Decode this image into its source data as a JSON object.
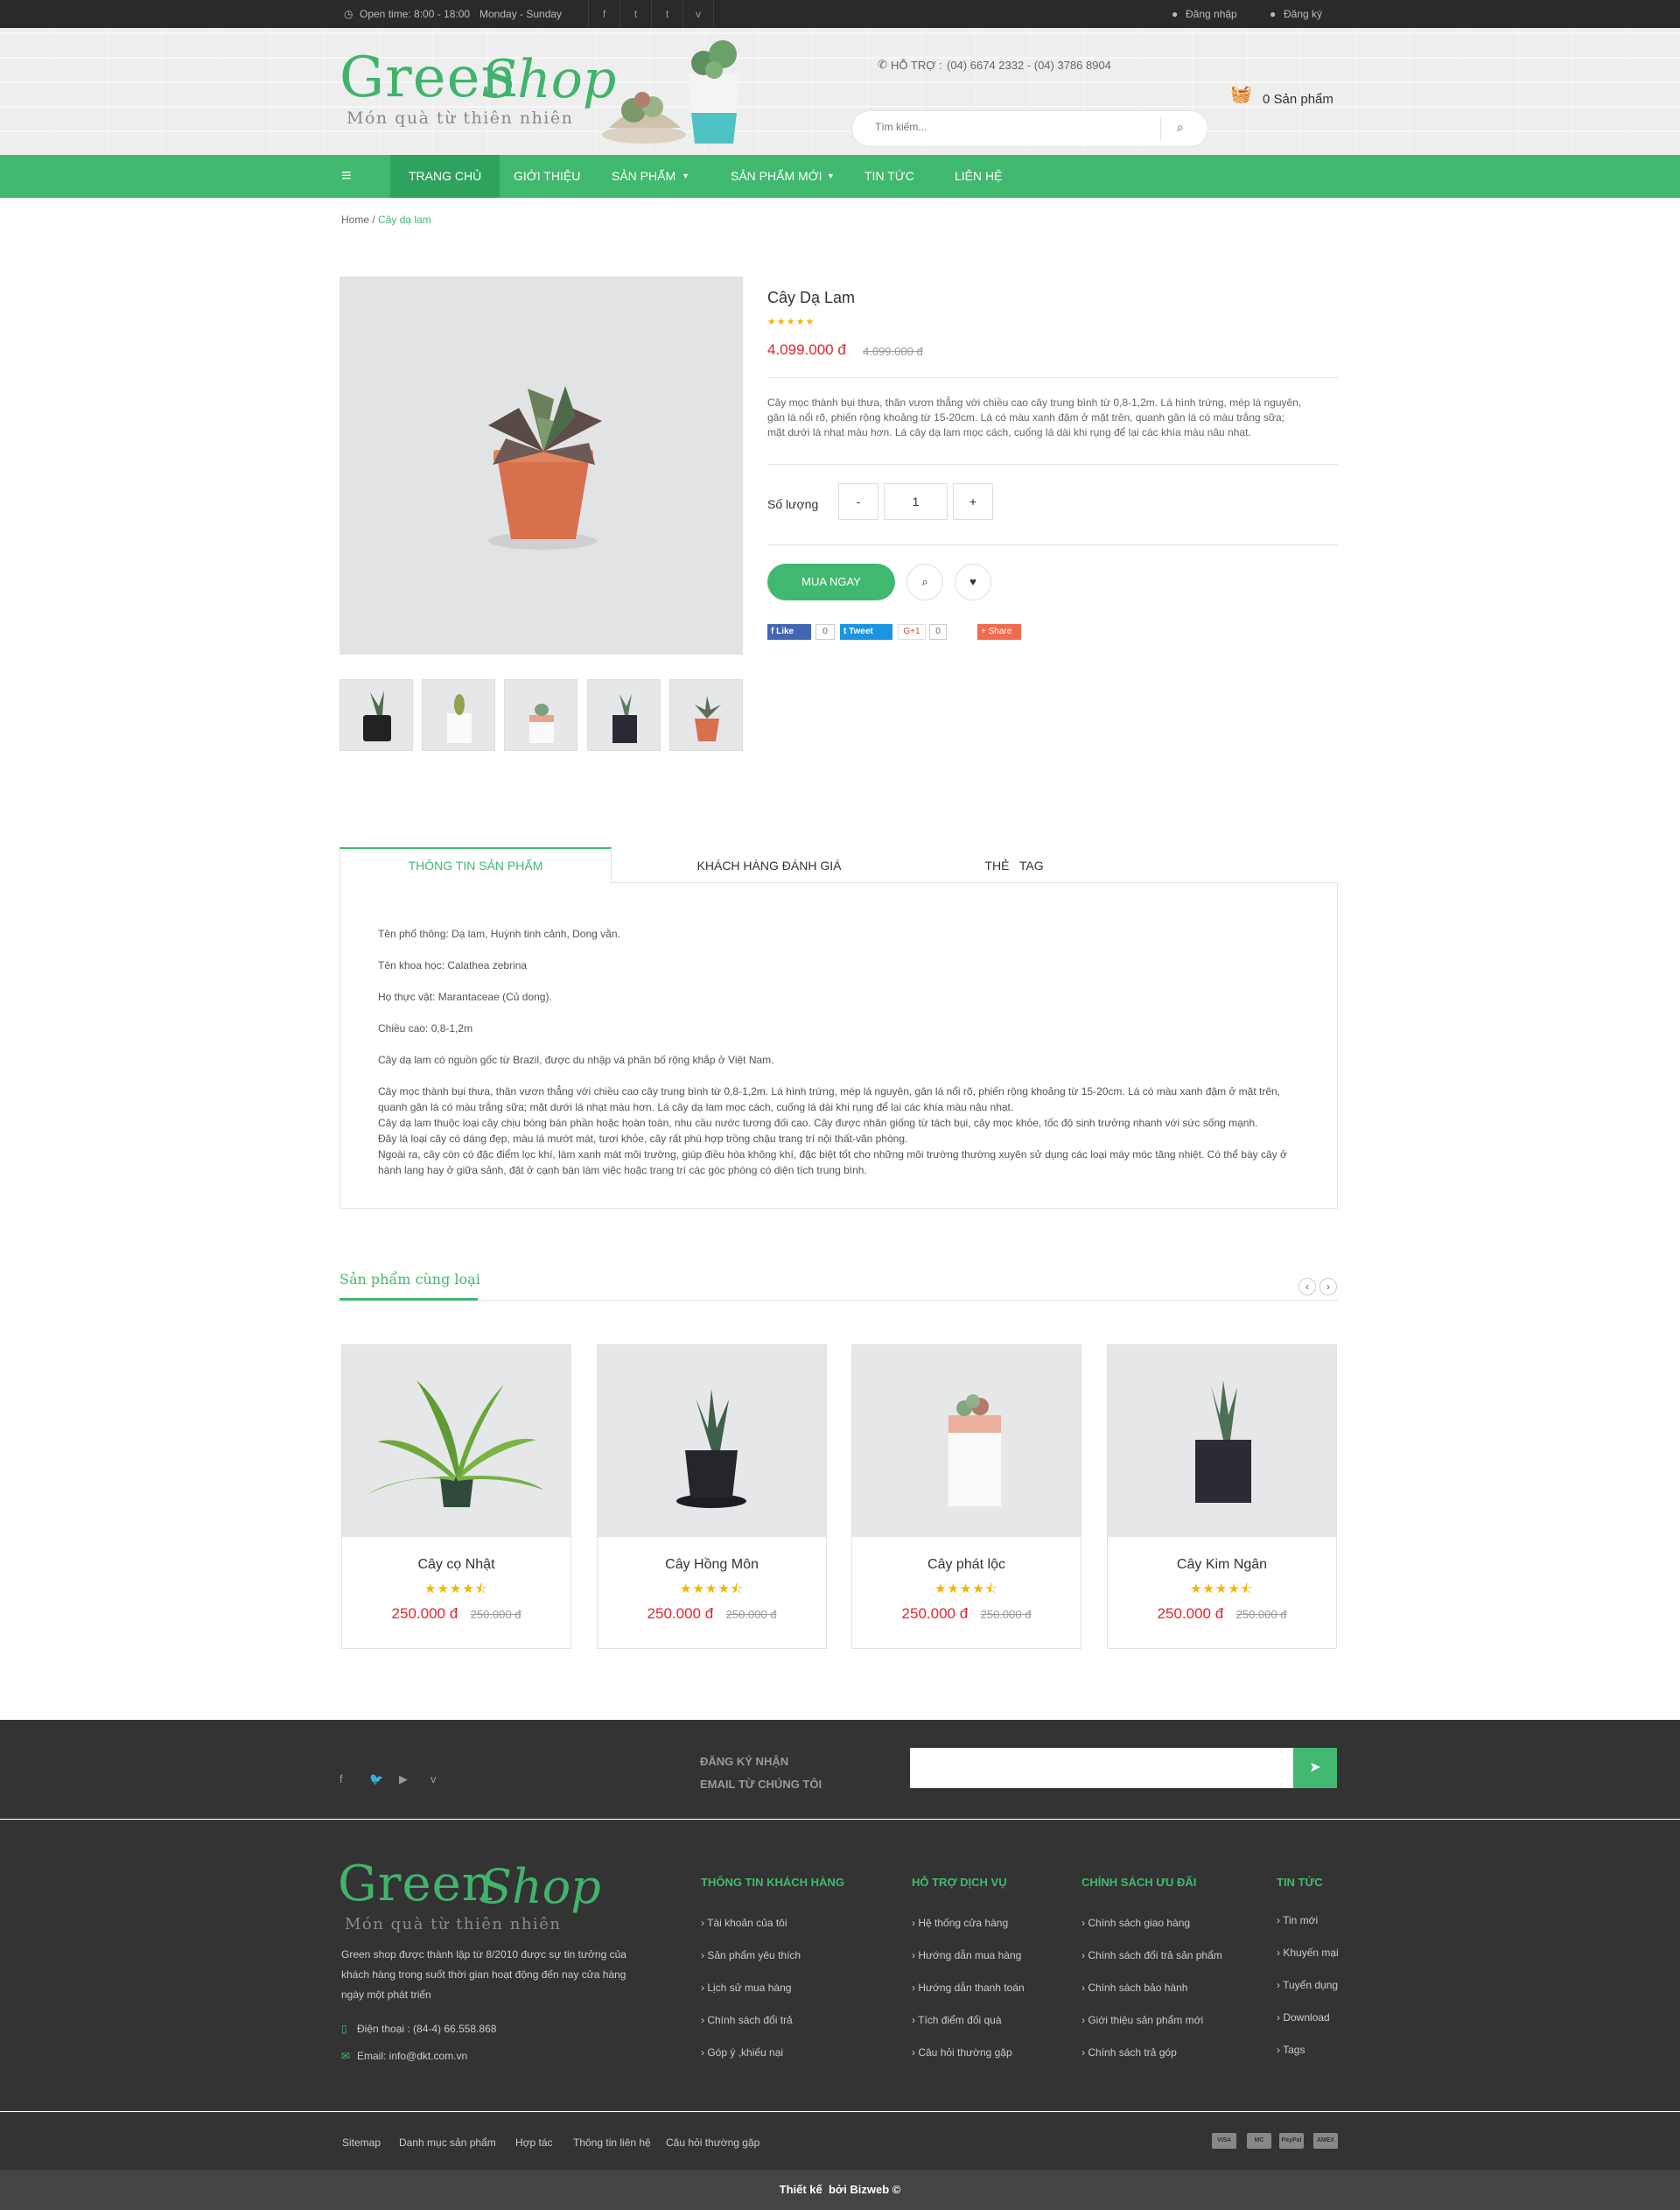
{
  "topbar": {
    "open_time": "Open time: 8:00 - 18:00",
    "days": "Monday - Sunday",
    "login": "Đăng nhập",
    "register": "Đăng ký"
  },
  "header": {
    "logo_green": "Green",
    "logo_shop": "Shop",
    "logo_tagline": "Món quà từ thiên nhiên",
    "support_label": "HỖ TRỢ :",
    "support_phones": "(04) 6674 2332 - (04) 3786 8904",
    "search_placeholder": "Tìm kiếm...",
    "cart_text": "0 Sản phẩm"
  },
  "nav": {
    "items": [
      "TRANG CHỦ",
      "GIỚI THIỆU",
      "SẢN PHẨM",
      "SẢN PHẨM MỚI",
      "TIN TỨC",
      "LIÊN HỆ"
    ]
  },
  "breadcrumb": {
    "home": "Home",
    "sep": "/",
    "current": "Cây dạ lam"
  },
  "product": {
    "name": "Cây Dạ Lam",
    "stars": "★★★★★",
    "price": "4.099.000 đ",
    "old_price": "4.099.000 đ",
    "short_desc": [
      "Cây mọc thành bụi thưa, thân vươn thẳng với chiều cao cây trung bình từ 0,8-1,2m. Lá hình trứng, mép lá nguyên,",
      "gân lá nổi rõ, phiến rộng khoảng từ 15-20cm. Lá có màu xanh đậm ở mặt trên, quanh gân lá có màu trắng sữa;",
      "mặt dưới lá nhạt màu hơn. Lá cây dạ lam mọc cách, cuống lá dài khi rụng để lại các khía màu nâu nhạt."
    ],
    "qty_label": "Số lượng",
    "qty_minus": "-",
    "qty_value": "1",
    "qty_plus": "+",
    "buy_label": "MUA NGAY",
    "social": {
      "like": "Like",
      "like_count": "0",
      "tweet": "Tweet",
      "tweet_count": "0",
      "gplus": "G+1",
      "gplus_count": "0",
      "share": "Share"
    }
  },
  "tabs": {
    "items": [
      "THÔNG TIN SẢN PHẨM",
      "KHÁCH HÀNG ĐÁNH GIÁ",
      "THẺ   TAG"
    ]
  },
  "details": {
    "lines": [
      "Tên phổ thông: Dạ lam, Huỳnh tinh cảnh, Dong vằn.",
      "Tên khoa học: Calathea zebrina",
      "Họ thực vật: Marantaceae (Củ dong).",
      "Chiều cao: 0,8-1,2m",
      "Cây dạ lam có nguồn gốc từ Brazil, được du nhập và phân bố rộng khắp ở Việt Nam."
    ],
    "para": [
      "Cây mọc thành bụi thưa, thân vươn thẳng với chiều cao cây trung bình từ 0,8-1,2m. Lá hình trứng, mép lá nguyên, gân lá nổi rõ, phiến rộng khoảng từ 15-20cm. Lá có màu xanh đậm ở mặt trên,",
      "quanh gân lá có màu trắng sữa; mặt dưới lá nhạt màu hơn. Lá cây dạ lam mọc cách, cuống lá dài khi rụng để lại các khía màu nâu nhạt.",
      "Cây dạ lam thuộc loại cây chịu bóng bán phần hoặc hoàn toàn, nhu cầu nước tương đối cao. Cây được nhân giống từ tách bụi, cây mọc khỏe, tốc độ sinh trưởng nhanh với sức sống mạnh.",
      "Đây là loại cây có dáng đẹp, màu lá mướt mát, tươi khỏe, cây rất phù hợp trồng chậu trang trí nội thất-văn phòng.",
      "Ngoài ra, cây còn có đặc điểm lọc khí, làm xanh mát môi trường, giúp điều hòa không khí, đặc biệt tốt cho những môi trường thường xuyên sử dụng các loại máy móc tăng nhiệt. Có thể bày cây ở",
      "hành lang hay ở giữa sảnh, đặt ở cạnh bàn làm việc hoặc trang trí các góc phòng có diện tích trung bình."
    ]
  },
  "related": {
    "title": "Sản phẩm cùng loại",
    "items": [
      {
        "name": "Cây cọ Nhật",
        "price": "250.000 đ",
        "old": "250.000 đ",
        "stars": "★★★★⯪"
      },
      {
        "name": "Cây Hồng Môn",
        "price": "250.000 đ",
        "old": "250.000 đ",
        "stars": "★★★★⯪"
      },
      {
        "name": "Cây phát lộc",
        "price": "250.000 đ",
        "old": "250.000 đ",
        "stars": "★★★★⯪"
      },
      {
        "name": "Cây Kim Ngân",
        "price": "250.000 đ",
        "old": "250.000 đ",
        "stars": "★★★★⯪"
      }
    ]
  },
  "newsletter": {
    "line1": "ĐĂNG KÝ NHẬN",
    "line2": "EMAIL TỪ CHÚNG TÔI"
  },
  "footer": {
    "about": [
      "Green shop được thành lập từ 8/2010 được sự tin tưởng của",
      "khách hàng trong suốt thời gian hoạt động đến nay cửa hàng",
      "ngày một phát triển"
    ],
    "phone": "Điện thoại : (84-4) 66.558.868",
    "email": "Email: info@dkt.com.vn",
    "cols": [
      {
        "title": "THÔNG TIN KHÁCH HÀNG",
        "links": [
          "Tài khoản của tôi",
          "Sản phẩm yêu thích",
          "Lịch sử mua hàng",
          "Chính sách đổi trả",
          "Góp ý ,khiếu nại"
        ]
      },
      {
        "title": "HỖ TRỢ DỊCH VỤ",
        "links": [
          "Hệ thống cửa hàng",
          "Hướng dẫn mua hàng",
          "Hướng dẫn thanh toán",
          "Tích điểm đổi quà",
          "Câu hỏi thường gặp"
        ]
      },
      {
        "title": "CHÍNH SÁCH ƯU ĐÃI",
        "links": [
          "Chính sách giao hàng",
          "Chính sách đổi trả sản phẩm",
          "Chính sách bảo hành",
          "Giới thiệu sản phẩm mới",
          "Chính sách trả góp"
        ]
      },
      {
        "title": "TIN TỨC",
        "links": [
          "Tin mới",
          "Khuyến mại",
          "Tuyển dụng",
          "Download",
          "Tags"
        ]
      }
    ],
    "bottom_links": [
      "Sitemap",
      "Danh mục sản phẩm",
      "Hợp tác",
      "Thông tin liên hệ",
      "Câu hỏi thường gặp"
    ],
    "payments": [
      "VISA",
      "MC",
      "PayPal",
      "AMEX"
    ],
    "copyright": "Thiết kế  bởi Bizweb ©"
  },
  "colors": {
    "brand_green": "#41b86f",
    "price_red": "#e8232c",
    "star": "#f4b400",
    "dark": "#333333"
  }
}
